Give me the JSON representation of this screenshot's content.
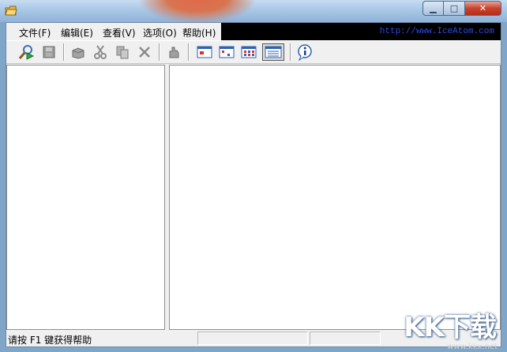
{
  "window": {
    "controls": {
      "minimize": "▁",
      "maximize": "□",
      "close": "✕"
    }
  },
  "menu": {
    "items": [
      {
        "label": "文件(F)"
      },
      {
        "label": "编辑(E)"
      },
      {
        "label": "查看(V)"
      },
      {
        "label": "选项(O)"
      },
      {
        "label": "帮助(H)"
      }
    ],
    "url": "http://www.IceAtom.com"
  },
  "toolbar": {
    "buttons": [
      {
        "icon": "search-run-icon"
      },
      {
        "icon": "disk-icon"
      },
      {
        "icon": "box-open-icon"
      },
      {
        "icon": "scissors-icon"
      },
      {
        "icon": "copy-icon"
      },
      {
        "icon": "delete-x-icon"
      },
      {
        "icon": "hand-icon"
      },
      {
        "icon": "large-icons-view-icon"
      },
      {
        "icon": "small-icons-view-icon"
      },
      {
        "icon": "list-view-icon"
      },
      {
        "icon": "details-view-icon",
        "pressed": true
      },
      {
        "icon": "info-icon"
      }
    ]
  },
  "status": {
    "text": "请按 F1 键获得帮助"
  },
  "watermark": {
    "logo": "KK下载",
    "url": "www.kkx.net"
  }
}
